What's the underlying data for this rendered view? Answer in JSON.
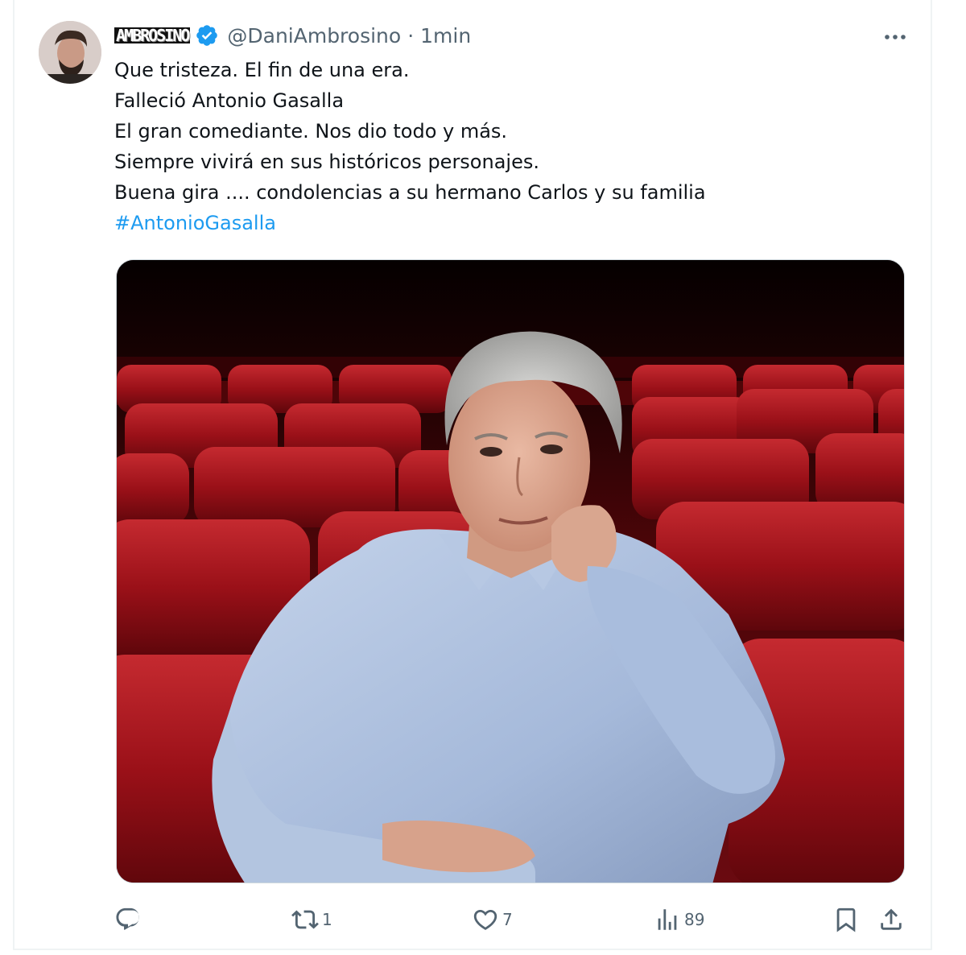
{
  "tweet": {
    "author": {
      "display_name": "AMBROSINO",
      "handle": "@DaniAmbrosino",
      "separator": "·",
      "time": "1min",
      "verified_icon": "verified-badge-icon"
    },
    "lines": [
      "Que tristeza. El fin de una era.",
      "Falleció Antonio Gasalla",
      "El gran comediante. Nos dio todo y más.",
      "Siempre vivirá en sus históricos personajes.",
      "Buena gira .... condolencias a su hermano Carlos y su familia"
    ],
    "hashtag": "#AntonioGasalla",
    "media": {
      "icon": "photo-icon"
    },
    "actions": {
      "reply": {
        "icon": "reply-icon",
        "count": ""
      },
      "retweet": {
        "icon": "retweet-icon",
        "count": "1"
      },
      "like": {
        "icon": "heart-icon",
        "count": "7"
      },
      "views": {
        "icon": "views-icon",
        "count": "89"
      },
      "bookmark": {
        "icon": "bookmark-icon"
      },
      "share": {
        "icon": "share-icon"
      }
    },
    "more_icon": "more-dots-icon"
  },
  "colors": {
    "link": "#1d9bf0",
    "muted": "#536471",
    "text": "#0f1419",
    "seat_red": "#8e0f16",
    "shirt_blue": "#a9bddd"
  }
}
